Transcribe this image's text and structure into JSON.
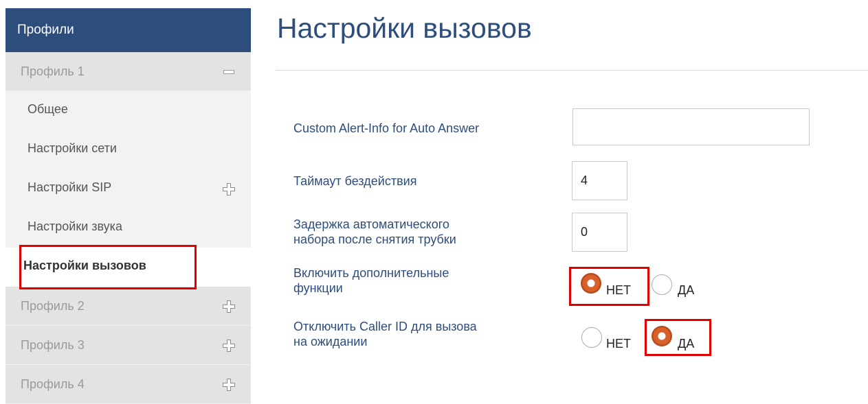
{
  "sidebar": {
    "header": "Профили",
    "profile1": {
      "label": "Профиль 1",
      "toggle": "minus-icon"
    },
    "sub_items": [
      {
        "label": "Общее"
      },
      {
        "label": "Настройки сети"
      },
      {
        "label": "Настройки SIP",
        "toggle": "plus-icon"
      },
      {
        "label": "Настройки звука"
      },
      {
        "label": "Настройки вызовов",
        "active": true
      }
    ],
    "profiles": [
      {
        "label": "Профиль 2",
        "toggle": "plus-icon"
      },
      {
        "label": "Профиль 3",
        "toggle": "plus-icon"
      },
      {
        "label": "Профиль 4",
        "toggle": "plus-icon"
      }
    ]
  },
  "main": {
    "title": "Настройки вызовов",
    "fields": {
      "custom_alert": {
        "label": "Custom Alert-Info for Auto Answer",
        "value": ""
      },
      "idle_timeout": {
        "label": "Таймаут бездействия",
        "value": "4"
      },
      "dial_delay": {
        "label_line1": "Задержка автоматического",
        "label_line2": "набора после снятия трубки",
        "value": "0"
      },
      "extra_functions": {
        "label_line1": "Включить дополнительные",
        "label_line2": "функции",
        "options": [
          "НЕТ",
          "ДА"
        ],
        "selected": "НЕТ"
      },
      "disable_caller_id": {
        "label_line1": "Отключить Caller ID для вызова",
        "label_line2": "на ожидании",
        "options": [
          "НЕТ",
          "ДА"
        ],
        "selected": "ДА"
      }
    }
  },
  "colors": {
    "accent": "#2d4d7c",
    "sidebar_bg": "#e3e3e3",
    "sub_item_bg": "#f2f2f2",
    "highlight": "#e00000",
    "radio_selected": "#d8602a"
  }
}
